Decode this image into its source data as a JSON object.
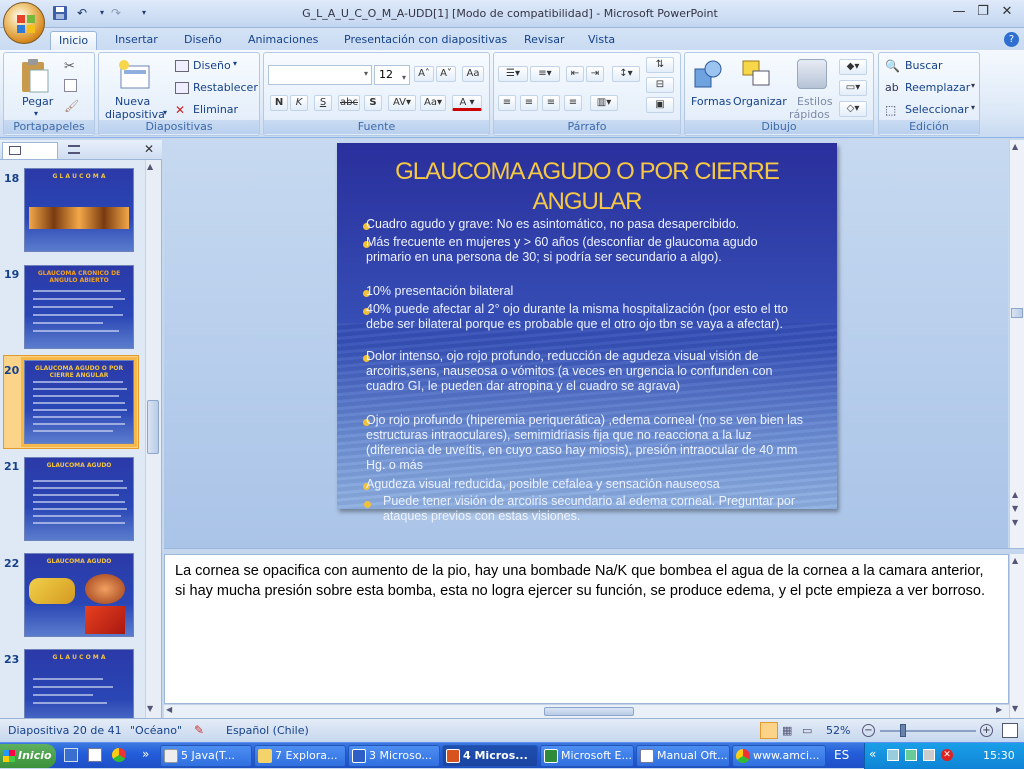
{
  "window": {
    "title": "G_L_A_U_C_O_M_A-UDD[1] [Modo de compatibilidad] - Microsoft PowerPoint",
    "minimize": "—",
    "restore": "❐",
    "close": "✕"
  },
  "ribbon_tabs": [
    "Inicio",
    "Insertar",
    "Diseño",
    "Animaciones",
    "Presentación con diapositivas",
    "Revisar",
    "Vista"
  ],
  "groups": {
    "portapapeles": {
      "label": "Portapapeles",
      "pegar": "Pegar"
    },
    "diapositivas": {
      "label": "Diapositivas",
      "nueva": "Nueva",
      "nueva2": "diapositiva",
      "diseno": "Diseño",
      "restablecer": "Restablecer",
      "eliminar": "Eliminar"
    },
    "fuente": {
      "label": "Fuente",
      "font_name": "",
      "font_size": "12"
    },
    "parrafo": {
      "label": "Párrafo"
    },
    "dibujo": {
      "label": "Dibujo",
      "formas": "Formas",
      "organizar": "Organizar",
      "estilos": "Estilos",
      "estilos2": "rápidos"
    },
    "edicion": {
      "label": "Edición",
      "buscar": "Buscar",
      "reemplazar": "Reemplazar",
      "seleccionar": "Seleccionar"
    }
  },
  "slides_panel": {
    "items": [
      {
        "num": "18",
        "title": "G L A U C O M A"
      },
      {
        "num": "19",
        "title": "GLAUCOMA CRONICO DE ANGULO ABIERTO"
      },
      {
        "num": "20",
        "title": "GLAUCOMA AGUDO O POR CIERRE ANGULAR"
      },
      {
        "num": "21",
        "title": "GLAUCOMA AGUDO"
      },
      {
        "num": "22",
        "title": "GLAUCOMA AGUDO"
      },
      {
        "num": "23",
        "title": "G L A U C O M A"
      }
    ]
  },
  "slide": {
    "title": "GLAUCOMA AGUDO O POR CIERRE ANGULAR",
    "bullets": [
      "Cuadro agudo y grave: No es asintomático, no pasa desapercibido.",
      "Más frecuente en mujeres y > 60 años (desconfiar de glaucoma agudo primario en una persona de 30; si podría ser secundario a algo).",
      "10% presentación bilateral",
      "40% puede afectar al 2° ojo durante la misma hospitalización (por esto el tto debe ser bilateral porque es probable que el otro ojo tbn se vaya a afectar).",
      "Dolor intenso, ojo rojo profundo, reducción de agudeza visual visión de arcoiris,sens, nauseosa o vómitos (a veces en urgencia lo confunden con cuadro GI, le pueden dar atropina y el cuadro se agrava)",
      "Ojo rojo profundo (hiperemia periquerática) ,edema corneal (no se ven bien las estructuras intraoculares), semimidriasis fija que no reacciona a la luz (diferencia de uveítis, en cuyo caso hay miosis), presión intraocular de 40 mm Hg. o más",
      "Agudeza visual reducida, posible cefalea y sensación nauseosa",
      "Puede tener visión de arcoiris secundario al edema corneal. Preguntar por ataques previos con estas visiones."
    ]
  },
  "notes": "La cornea se opacifica con aumento de la pio, hay una bombade Na/K que bombea el agua de la cornea a la camara anterior, si hay mucha presión sobre esta bomba, esta no logra ejercer su función, se produce edema, y el pcte empieza a ver borroso.",
  "status": {
    "slide_counter": "Diapositiva 20 de 41",
    "theme": "\"Océano\"",
    "language": "Español (Chile)",
    "zoom": "52%"
  },
  "taskbar": {
    "start": "Inicio",
    "tasks": [
      "5 Java(T...",
      "7 Explora...",
      "3 Microso...",
      "4 Micros...",
      "Microsoft E...",
      "Manual Oft...",
      "www.amci..."
    ],
    "lang": "ES",
    "clock": "15:30"
  },
  "colors": {
    "slide_title": "#f6c843",
    "bullet": "#f0c23c",
    "ribbon_text": "#15428b"
  }
}
